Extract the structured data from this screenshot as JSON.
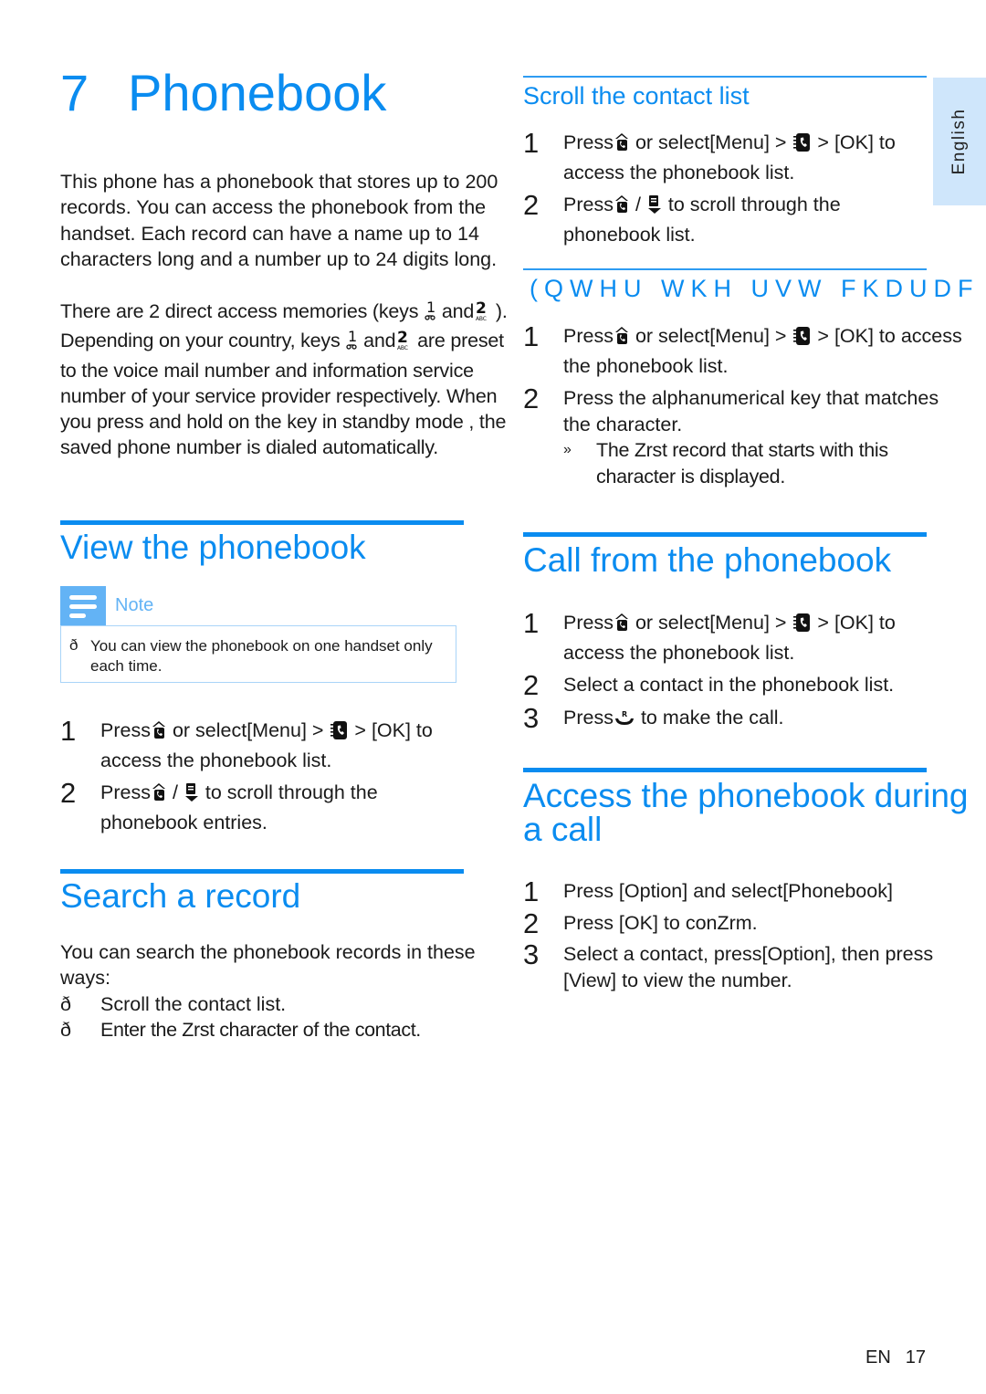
{
  "chapter": {
    "number": "7",
    "title": "Phonebook"
  },
  "intro": {
    "paragraph_1": "This phone has a phonebook that stores up to 200 records. You can access the phonebook from the handset. Each record can have a name up to 14 characters long and a number up to 24 digits long.",
    "paragraph_2_parts": {
      "a": "There are 2 direct access memories (keys ",
      "b": " and",
      "c": " ). Depending on your country, keys ",
      "d": " and",
      "e": " are preset to the voice mail number and information service number of your service provider respectively. When you press and hold on the key in standby mode , the saved phone number is dialed automatically."
    }
  },
  "view_section": {
    "title": "View the phonebook",
    "note": {
      "label": "Note",
      "bullet": "ð",
      "text": "You can view the phonebook on one handset only each time."
    },
    "steps": [
      {
        "n": "1",
        "pre": "Press",
        "mid": " or select[Menu] > ",
        "post": " > [OK] to access the phonebook list."
      },
      {
        "n": "2",
        "pre": "Press",
        "mid": " / ",
        "post": " to scroll through the phonebook entries."
      }
    ]
  },
  "search_section": {
    "title": "Search a record",
    "intro": "You can search the phonebook records in these ways:",
    "bullet_glyph": "ð",
    "bullets": [
      "Scroll the contact list.",
      "Enter the Zrst character of the contact."
    ]
  },
  "scroll_section": {
    "title": "Scroll the contact list",
    "steps": [
      {
        "n": "1",
        "pre": "Press",
        "mid": " or select[Menu] > ",
        "post": " > [OK] to access the phonebook list."
      },
      {
        "n": "2",
        "pre": "Press",
        "mid": " / ",
        "post": " to scroll through the phonebook list."
      }
    ]
  },
  "enter_section": {
    "title": "(QWHU WKH  UVW FKDUDF",
    "steps": [
      {
        "n": "1",
        "pre": "Press",
        "mid": " or select[Menu] > ",
        "post": " > [OK] to access the phonebook list."
      },
      {
        "n": "2",
        "text": "Press the alphanumerical key that matches the character."
      }
    ],
    "result_mark": "»",
    "result_text": "The Zrst record that starts with this character is displayed."
  },
  "call_section": {
    "title": "Call from the phonebook",
    "steps": [
      {
        "n": "1",
        "pre": "Press",
        "mid": " or select[Menu] > ",
        "post": " > [OK] to access the phonebook list."
      },
      {
        "n": "2",
        "text": "Select a contact in the phonebook list."
      },
      {
        "n": "3",
        "pre": "Press",
        "post": " to make the call."
      }
    ]
  },
  "during_call_section": {
    "title_line1": "Access the phonebook during",
    "title_line2": "a call",
    "steps": [
      {
        "n": "1",
        "text": "Press [Option] and select[Phonebook]"
      },
      {
        "n": "2",
        "text": "Press [OK] to conZrm."
      },
      {
        "n": "3",
        "text": "Select a contact, press[Option], then press [View] to view the number."
      }
    ]
  },
  "language_tab": "English",
  "footer": {
    "lang": "EN",
    "page": "17"
  },
  "colors": {
    "accent": "#0a8cf0",
    "note_accent": "#63b3f5",
    "lang_tab_bg": "#cfe6fb"
  }
}
